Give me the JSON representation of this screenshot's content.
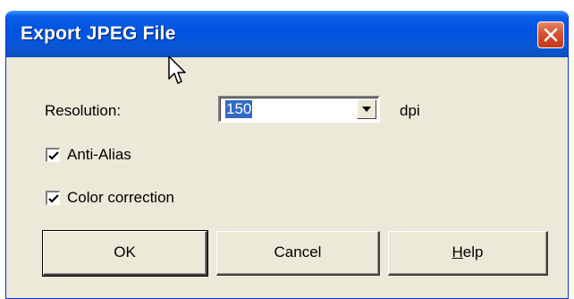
{
  "window": {
    "title": "Export JPEG File"
  },
  "icons": {
    "close": "close-icon",
    "cursor": "mouse-pointer-icon",
    "dropdown": "chevron-down-icon",
    "check": "checkmark-icon"
  },
  "colors": {
    "titlebar": "#0054e3",
    "dialog_bg": "#ece9d8",
    "selection": "#316ac5",
    "close_button": "#d9512f"
  },
  "form": {
    "resolution_label": "Resolution:",
    "resolution_value": "150",
    "resolution_unit": "dpi",
    "anti_alias_label": "Anti-Alias",
    "anti_alias_checked": true,
    "color_correction_label": "Color correction",
    "color_correction_checked": true
  },
  "buttons": {
    "ok": "OK",
    "cancel": "Cancel",
    "help_mnemonic": "H",
    "help_rest": "elp"
  }
}
